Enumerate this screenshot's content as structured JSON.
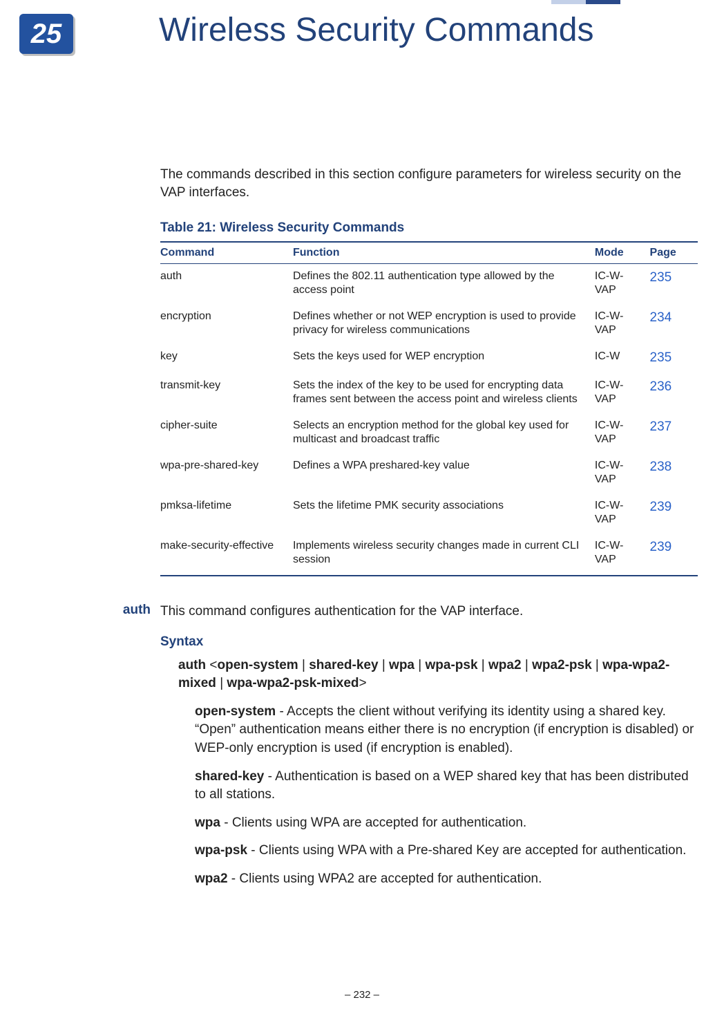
{
  "chapter": {
    "number": "25",
    "title": "Wireless Security Commands"
  },
  "intro": "The commands described in this section configure parameters for wireless security on the VAP interfaces.",
  "table": {
    "caption": "Table 21: Wireless Security Commands",
    "headers": {
      "command": "Command",
      "function": "Function",
      "mode": "Mode",
      "page": "Page"
    },
    "rows": [
      {
        "command": "auth",
        "function": "Defines the 802.11 authentication type allowed by the access point",
        "mode": "IC-W-VAP",
        "page": "235"
      },
      {
        "command": "encryption",
        "function": "Defines whether or not WEP encryption is used to provide privacy for wireless communications",
        "mode": "IC-W-VAP",
        "page": "234"
      },
      {
        "command": "key",
        "function": "Sets the keys used for WEP encryption",
        "mode": "IC-W",
        "page": "235"
      },
      {
        "command": "transmit-key",
        "function": "Sets the index of the key to be used for encrypting data frames sent between the access point and wireless clients",
        "mode": "IC-W-VAP",
        "page": "236"
      },
      {
        "command": "cipher-suite",
        "function": "Selects an encryption method for the global key used for multicast and broadcast traffic",
        "mode": "IC-W-VAP",
        "page": "237"
      },
      {
        "command": "wpa-pre-shared-key",
        "function": "Defines a WPA preshared-key value",
        "mode": "IC-W-VAP",
        "page": "238"
      },
      {
        "command": "pmksa-lifetime",
        "function": "Sets the lifetime PMK security associations",
        "mode": "IC-W-VAP",
        "page": "239"
      },
      {
        "command": "make-security-effective",
        "function": "Implements wireless security changes made in current CLI session",
        "mode": "IC-W-VAP",
        "page": "239"
      }
    ]
  },
  "section": {
    "side_label": "auth",
    "desc": "This command configures authentication for the VAP interface.",
    "syntax_head": "Syntax",
    "syntax": {
      "cmd": "auth",
      "lt": "<",
      "gt": ">",
      "sep": " | ",
      "opts": [
        "open-system",
        "shared-key",
        "wpa",
        "wpa-psk",
        "wpa2",
        "wpa2-psk",
        "wpa-wpa2-mixed",
        "wpa-wpa2-psk-mixed"
      ]
    },
    "params": [
      {
        "name": "open-system",
        "desc": " - Accepts the client without verifying its identity using a shared key. “Open” authentication means either there is no encryption (if encryption is disabled) or WEP-only encryption is used (if encryption is enabled)."
      },
      {
        "name": "shared-key",
        "desc": " - Authentication is based on a WEP shared key that has been distributed to all stations."
      },
      {
        "name": "wpa",
        "desc": " - Clients using WPA are accepted for authentication."
      },
      {
        "name": "wpa-psk",
        "desc": " - Clients using WPA with a Pre-shared Key are accepted for authentication."
      },
      {
        "name": "wpa2",
        "desc": " - Clients using WPA2 are accepted for authentication."
      }
    ]
  },
  "footer": "–  232  –"
}
